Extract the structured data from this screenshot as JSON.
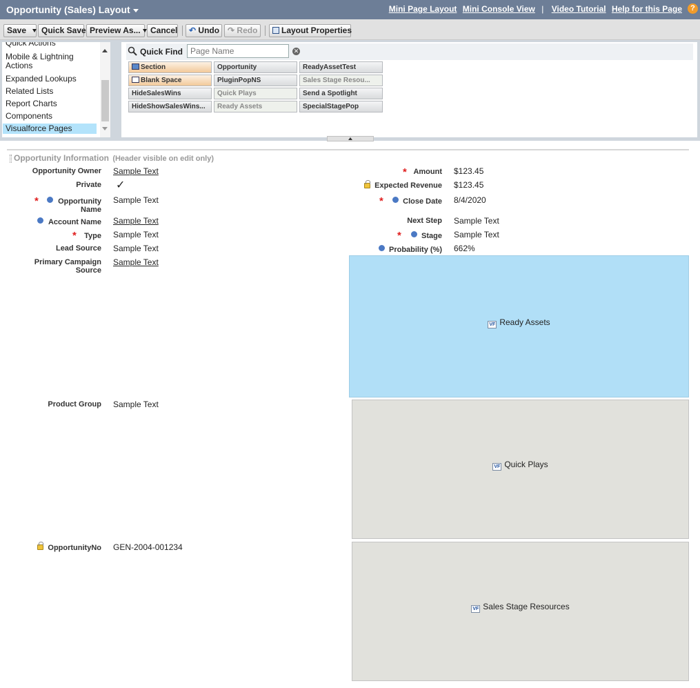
{
  "header": {
    "title": "Opportunity (Sales) Layout",
    "links": [
      "Mini Page Layout",
      "Mini Console View",
      "Video Tutorial",
      "Help for this Page"
    ],
    "separator": "|",
    "help_glyph": "?"
  },
  "toolbar": {
    "save": "Save",
    "quick_save": "Quick Save",
    "preview_as": "Preview As...",
    "cancel": "Cancel",
    "undo": "Undo",
    "redo": "Redo",
    "layout_properties": "Layout Properties"
  },
  "categories": {
    "items": [
      "Quick Actions",
      "Mobile & Lightning Actions",
      "Expanded Lookups",
      "Related Lists",
      "Report Charts",
      "Components",
      "Visualforce Pages"
    ],
    "selected": "Visualforce Pages"
  },
  "quick_find": {
    "label": "Quick Find",
    "placeholder": "Page Name",
    "clear_glyph": "✕"
  },
  "palette_items": [
    [
      "Section",
      "Opportunity",
      "ReadyAssetTest"
    ],
    [
      "Blank Space",
      "PluginPopNS",
      "Sales Stage Resou..."
    ],
    [
      "HideSalesWins",
      "Quick Plays",
      "Send a Spotlight"
    ],
    [
      "HideShowSalesWins...",
      "Ready Assets",
      "SpecialStagePop"
    ]
  ],
  "section": {
    "title": "Opportunity Information",
    "note": "(Header visible on edit only)"
  },
  "left_fields": [
    {
      "label": "Opportunity Owner",
      "value": "Sample Text"
    },
    {
      "label": "Private",
      "value": "✓"
    },
    {
      "label": "Opportunity Name",
      "value": "Sample Text"
    },
    {
      "label": "Account Name",
      "value": "Sample Text"
    },
    {
      "label": "Type",
      "value": "Sample Text"
    },
    {
      "label": "Lead Source",
      "value": "Sample Text"
    },
    {
      "label": "Primary Campaign Source",
      "value": "Sample Text"
    },
    {
      "label": "Product Group",
      "value": "Sample Text"
    },
    {
      "label": "OpportunityNo",
      "value": "GEN-2004-001234"
    }
  ],
  "right_fields": [
    {
      "label": "Amount",
      "value": "$123.45"
    },
    {
      "label": "Expected Revenue",
      "value": "$123.45"
    },
    {
      "label": "Close Date",
      "value": "8/4/2020"
    },
    {
      "label": "Next Step",
      "value": "Sample Text"
    },
    {
      "label": "Stage",
      "value": "Sample Text"
    },
    {
      "label": "Probability (%)",
      "value": "662%"
    }
  ],
  "vf_pages": [
    "Ready Assets",
    "Quick Plays",
    "Sales Stage Resources"
  ],
  "vf_icon_text": "VF",
  "required_marker": "*",
  "colors": {
    "header_bar": "#6d7e97",
    "selected_item": "#b3e3fb",
    "vf_selected": "#b1dff7",
    "vf_default": "#e1e1dc",
    "required": "#e02020",
    "help": "#f09b2b"
  }
}
